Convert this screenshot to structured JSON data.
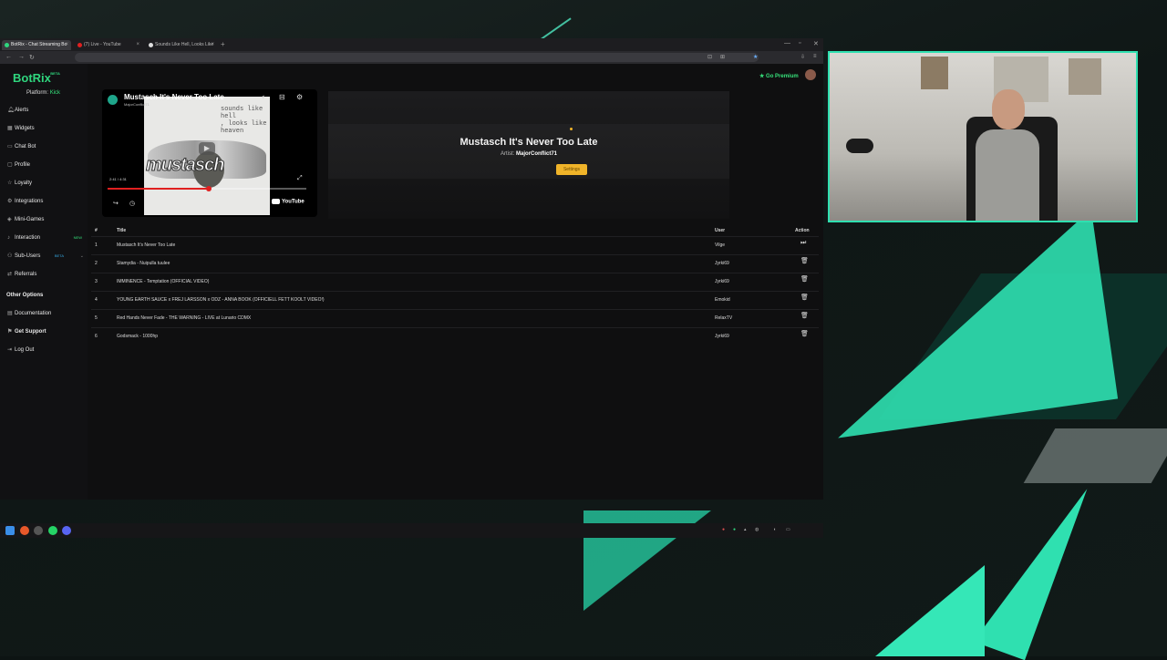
{
  "browser": {
    "tabs": [
      {
        "label": "BotRix - Chat Streaming Bo",
        "color": "#2fd67e",
        "active": true
      },
      {
        "label": "(7) Live - YouTube",
        "color": "#e02020",
        "active": false
      },
      {
        "label": "Sounds Like Hell, Looks Like H",
        "color": "#dddddd",
        "active": false
      }
    ]
  },
  "app": {
    "logo": "BotRix",
    "beta": "BETA",
    "platform_label": "Platform:",
    "platform_value": "Kick",
    "go_premium": "Go Premium"
  },
  "sidebar": {
    "items": [
      {
        "label": "Alerts",
        "icon": "bell-icon"
      },
      {
        "label": "Widgets",
        "icon": "grid-icon"
      },
      {
        "label": "Chat Bot",
        "icon": "chat-icon"
      },
      {
        "label": "Profile",
        "icon": "user-icon"
      },
      {
        "label": "Loyalty",
        "icon": "star-icon"
      },
      {
        "label": "Integrations",
        "icon": "plug-icon"
      },
      {
        "label": "Mini-Games",
        "icon": "gamepad-icon"
      },
      {
        "label": "Interaction",
        "icon": "music-icon",
        "tag": "NEW"
      },
      {
        "label": "Sub-Users",
        "icon": "users-icon",
        "tag": "BETA",
        "expandable": true
      },
      {
        "label": "Referrals",
        "icon": "share-icon"
      }
    ],
    "other_heading": "Other Options",
    "other_items": [
      {
        "label": "Documentation",
        "icon": "book-icon"
      },
      {
        "label": "Get Support",
        "icon": "support-icon",
        "bold": true
      },
      {
        "label": "Log Out",
        "icon": "logout-icon"
      }
    ]
  },
  "player": {
    "title": "Mustasch It's Never Too Late",
    "channel": "MajorConflict71",
    "time": "2:41 / 4:31",
    "progress": 0.51,
    "cover_text": "sounds like\nhell\n, looks like\nheaven",
    "band": "mustasch",
    "youtube_label": "YouTube"
  },
  "now_playing": {
    "title": "Mustasch It's Never Too Late",
    "artist_label": "Artist:",
    "artist": "MajorConflict71",
    "button": "Settings"
  },
  "queue": {
    "headers": {
      "num": "#",
      "title": "Title",
      "user": "User",
      "action": "Action"
    },
    "rows": [
      {
        "num": "1",
        "title": "Mustasch It's Never Too Late",
        "user": "Vilge",
        "action": "skip"
      },
      {
        "num": "2",
        "title": "Stamydia - Nuipulla tuulee",
        "user": "Jyrki69",
        "action": "delete"
      },
      {
        "num": "3",
        "title": "IMMINENCE - Temptation (OFFICIAL VIDEO)",
        "user": "Jyrki69",
        "action": "delete"
      },
      {
        "num": "4",
        "title": "YOUNG EARTH SAUCE x FREJ LARSSON x ODZ - ANNA BOOK (OFFICIELL FETT KOOLT VIDEO!)",
        "user": "Emokid",
        "action": "delete"
      },
      {
        "num": "5",
        "title": "Red Hands Never Fade - THE WARNING - LIVE at Lunario CDMX",
        "user": "RelaxTV",
        "action": "delete"
      },
      {
        "num": "6",
        "title": "Godsmack - 1000hp",
        "user": "Jyrki69",
        "action": "delete"
      }
    ]
  },
  "colors": {
    "accent": "#2fd67e",
    "button": "#f0b429",
    "cam_border": "#2fe0b0"
  }
}
